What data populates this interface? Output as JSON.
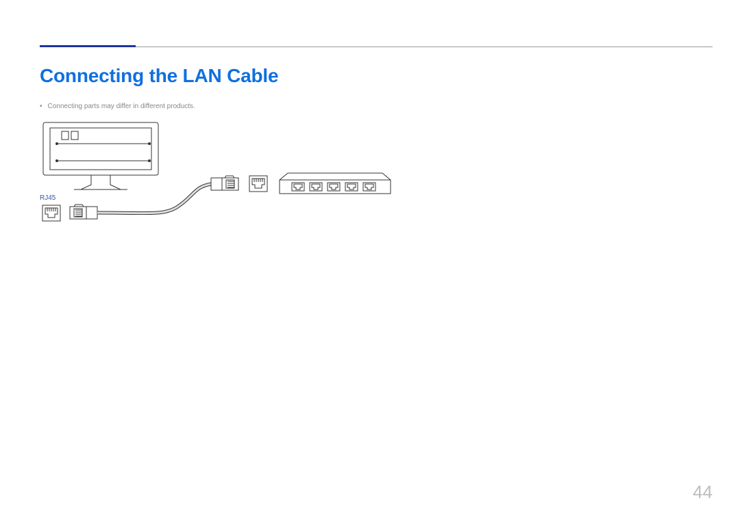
{
  "title": "Connecting the LAN Cable",
  "note": "Connecting parts may differ in different products.",
  "port_label": "RJ45",
  "page_number": "44"
}
